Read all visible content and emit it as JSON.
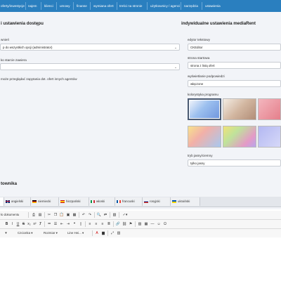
{
  "nav": {
    "items": [
      "oferty/inwestycje",
      "najem",
      "klienci",
      "umowy",
      "finanse",
      "wymiana ofert",
      "treści na stronie",
      "użytkownicy / agenci",
      "narzędzia",
      "ustawienia"
    ]
  },
  "left": {
    "title": "i ustawienia dostępu",
    "field1_label": "wnień",
    "field1_value": "p do wszystkich opcji (administrator)",
    "field2_label": "ko starcie zawiera",
    "field2_value": "",
    "note": "może przeglądać zapytania dot. ofert innych agentów"
  },
  "right": {
    "title": "indywidualne ustawienia mediaRent",
    "editor_label": "edytor tekstowy",
    "editor_value": "CKEditor",
    "start_label": "strona startowa",
    "start_value": "strona z listą ofert",
    "hints_label": "wyświetlanie podpowiedzi",
    "hints_value": "włączone",
    "colors_label": "kolorystyka programu",
    "mode_label": "tryb jasny/ciemny",
    "mode_value": "tylko jasny"
  },
  "user_section_title": "townika",
  "language_tabs": [
    "angielski",
    "niemiecki",
    "hiszpański",
    "włoski",
    "francuski",
    "rosyjski",
    "ukraiński"
  ],
  "editor_toolbar": {
    "doc_label": "ło dokumentu",
    "font_label": "Czcionka",
    "size_label": "Rozmiar",
    "lineheight_label": "Line Hei..."
  },
  "colors": {
    "nav": "#2a7fbf",
    "panel": "#f2f4f8"
  }
}
